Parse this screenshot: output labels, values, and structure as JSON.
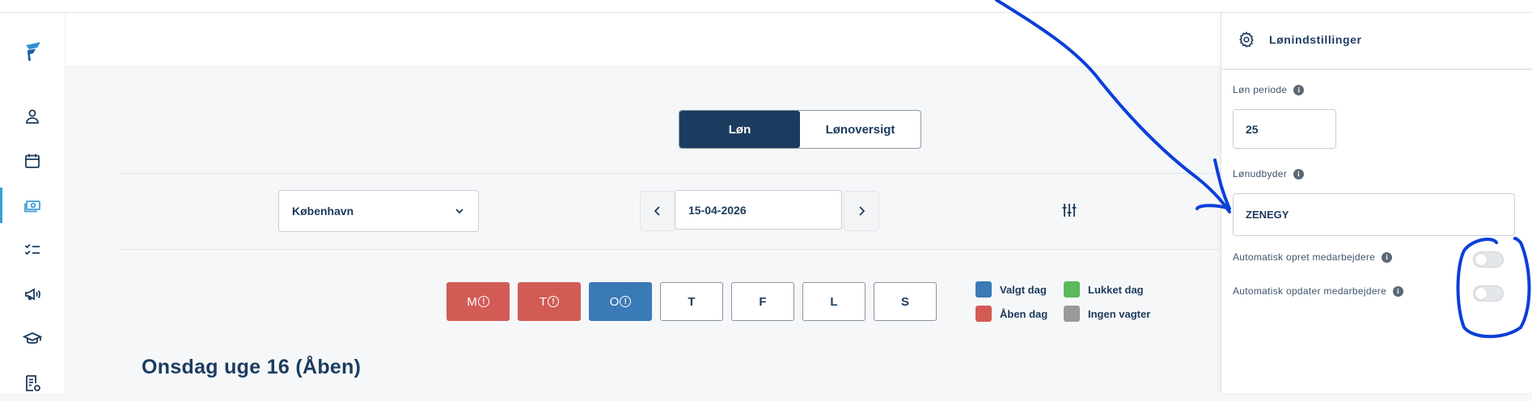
{
  "tabs": {
    "lon": "Løn",
    "lonoversigt": "Lønoversigt"
  },
  "location": {
    "selected": "København"
  },
  "date": {
    "value": "15-04-2026"
  },
  "days": [
    {
      "label": "M",
      "warning": "!",
      "state": "open"
    },
    {
      "label": "T",
      "warning": "!",
      "state": "open"
    },
    {
      "label": "O",
      "warning": "!",
      "state": "selected"
    },
    {
      "label": "T",
      "warning": "",
      "state": "normal"
    },
    {
      "label": "F",
      "warning": "",
      "state": "normal"
    },
    {
      "label": "L",
      "warning": "",
      "state": "normal"
    },
    {
      "label": "S",
      "warning": "",
      "state": "normal"
    }
  ],
  "legend": {
    "valgt": "Valgt dag",
    "lukket": "Lukket dag",
    "aaben": "Åben dag",
    "ingen": "Ingen vagter"
  },
  "colors": {
    "valgt": "#3a7ab6",
    "lukket": "#5cb85c",
    "aaben": "#d25b56",
    "ingen": "#9a9a9a",
    "primary": "#1b3c5f",
    "annotation": "#0a3fd9"
  },
  "heading": "Onsdag uge 16 (Åben)",
  "panel": {
    "title": "Lønindstillinger",
    "periode_label": "Løn periode",
    "periode_value": "25",
    "udbyder_label": "Lønudbyder",
    "udbyder_value": "ZENEGY",
    "auto_opret_label": "Automatisk opret medarbejdere",
    "auto_opdater_label": "Automatisk opdater medarbejdere",
    "auto_opret_on": false,
    "auto_opdater_on": false
  },
  "icons": {
    "sidebar": [
      "user-icon",
      "calendar-icon",
      "money-icon",
      "checklist-icon",
      "megaphone-icon",
      "graduation-cap-icon",
      "document-settings-icon"
    ]
  }
}
